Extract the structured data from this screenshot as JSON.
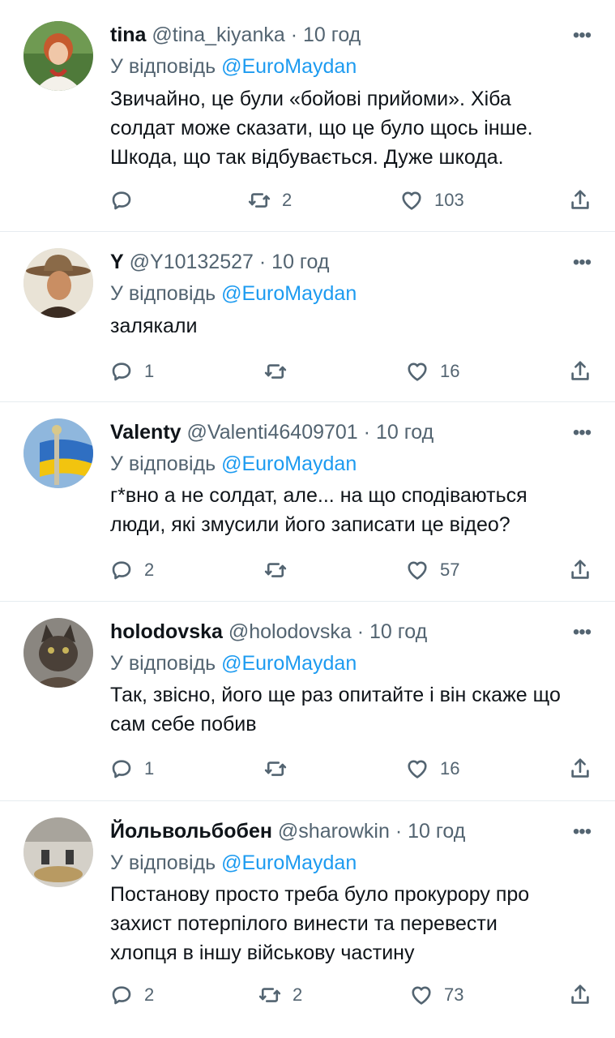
{
  "reply_prefix": "У відповідь",
  "tweets": [
    {
      "name": "tina",
      "handle": "@tina_kiyanka",
      "dot": "·",
      "time": "10 год",
      "reply_to": "@EuroMaydan",
      "text": "Звичайно, це були «бойові прийоми». Хіба\nсолдат може сказати, що це було щось інше.\nШкода, що так відбувається. Дуже шкода.",
      "replies": "",
      "retweets": "2",
      "likes": "103",
      "avatar_icon": "woman-portrait-avatar"
    },
    {
      "name": "Y",
      "handle": "@Y10132527",
      "dot": "·",
      "time": "10 год",
      "reply_to": "@EuroMaydan",
      "text": "залякали",
      "replies": "1",
      "retweets": "",
      "likes": "16",
      "avatar_icon": "cowboy-avatar"
    },
    {
      "name": "Valenty",
      "handle": "@Valenti46409701",
      "dot": "·",
      "time": "10 год",
      "reply_to": "@EuroMaydan",
      "text": "г*вно а не солдат, але... на що сподіваються\nлюди, які змусили його записати це відео?",
      "replies": "2",
      "retweets": "",
      "likes": "57",
      "avatar_icon": "ukraine-flag-monument-avatar"
    },
    {
      "name": "holodovska",
      "handle": "@holodovska",
      "dot": "·",
      "time": "10 год",
      "reply_to": "@EuroMaydan",
      "text": "Так, звісно, його ще раз опитайте і він скаже що\nсам себе побив",
      "replies": "1",
      "retweets": "",
      "likes": "16",
      "avatar_icon": "cat-avatar"
    },
    {
      "name": "Йольвольбобен",
      "handle": "@sharowkin",
      "dot": "·",
      "time": "10 год",
      "reply_to": "@EuroMaydan",
      "text": "Постанову просто треба було прокурору про\nзахист потерпілого винести та перевести\nхлопця в іншу військову частину",
      "replies": "2",
      "retweets": "2",
      "likes": "73",
      "avatar_icon": "photo-avatar"
    }
  ],
  "colors": {
    "text": "#0f1419",
    "secondary": "#536471",
    "link": "#1d9bf0",
    "divider": "#e6ecf0"
  }
}
